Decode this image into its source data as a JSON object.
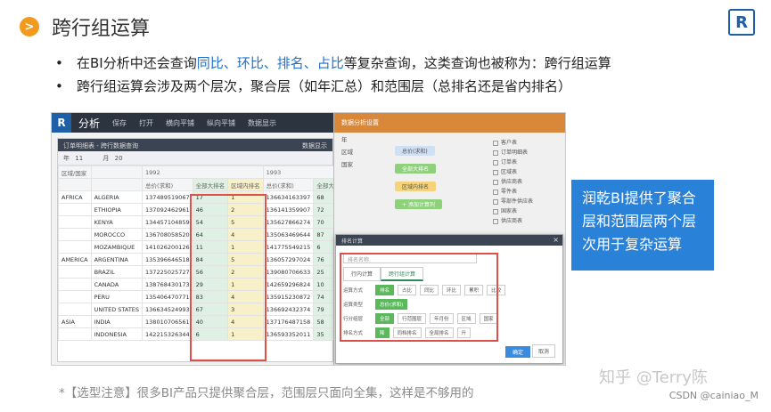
{
  "slide": {
    "title": "跨行组运算",
    "title_bullet": ">",
    "logo_letter": "R"
  },
  "bullets": {
    "line1_pre": "在BI分析中还会查询",
    "line1_highlight": "同比、环比、排名、占比",
    "line1_post": "等复杂查询，这类查询也被称为：跨行组运算",
    "line2": "跨行组运算会涉及两个层次，聚合层（如年汇总）和范围层（总排名还是省内排名）"
  },
  "app": {
    "logo": "R",
    "title": "分析",
    "menu": [
      "保存",
      "打开",
      "横向平铺",
      "纵向平铺",
      "数据显示"
    ],
    "panel_title": "订单明细表 - 跨行数据查询",
    "panel_right_label": "数据显示",
    "filter_year_label": "年",
    "filter_month_label": "月",
    "filter_value_a": "11",
    "filter_value_b": "20",
    "col_region": "区域/国家",
    "col_year_a": "1992",
    "col_year_b": "1993",
    "sub_headers": [
      "总价(求和)",
      "全部大排名",
      "区域内排名",
      "总价(求和)",
      "全部大排名"
    ],
    "rows": [
      {
        "region": "AFRICA",
        "country": "ALGERIA",
        "v1": "137489519067",
        "r1": "17",
        "r2": "1",
        "v2": "136634163397",
        "r3": "68"
      },
      {
        "region": "",
        "country": "ETHIOPIA",
        "v1": "137092462961",
        "r1": "46",
        "r2": "2",
        "v2": "136141359907",
        "r3": "72"
      },
      {
        "region": "",
        "country": "KENYA",
        "v1": "134457104859",
        "r1": "54",
        "r2": "5",
        "v2": "135627866274",
        "r3": "70"
      },
      {
        "region": "",
        "country": "MOROCCO",
        "v1": "136708058520",
        "r1": "64",
        "r2": "4",
        "v2": "135063469644",
        "r3": "87"
      },
      {
        "region": "",
        "country": "MOZAMBIQUE",
        "v1": "141026200126",
        "r1": "11",
        "r2": "1",
        "v2": "141775549215",
        "r3": "6"
      },
      {
        "region": "AMERICA",
        "country": "ARGENTINA",
        "v1": "135396646518",
        "r1": "84",
        "r2": "5",
        "v2": "136057297024",
        "r3": "76"
      },
      {
        "region": "",
        "country": "BRAZIL",
        "v1": "137225025727",
        "r1": "56",
        "r2": "2",
        "v2": "139080706633",
        "r3": "25"
      },
      {
        "region": "",
        "country": "CANADA",
        "v1": "138768430173",
        "r1": "29",
        "r2": "1",
        "v2": "142659296824",
        "r3": "10"
      },
      {
        "region": "",
        "country": "PERU",
        "v1": "135406470771",
        "r1": "83",
        "r2": "4",
        "v2": "135915230872",
        "r3": "74"
      },
      {
        "region": "",
        "country": "UNITED STATES",
        "v1": "136634524993",
        "r1": "67",
        "r2": "3",
        "v2": "136692432374",
        "r3": "79"
      },
      {
        "region": "ASIA",
        "country": "INDIA",
        "v1": "138010706561",
        "r1": "40",
        "r2": "4",
        "v2": "137176487158",
        "r3": "58"
      },
      {
        "region": "",
        "country": "INDONESIA",
        "v1": "142215326344",
        "r1": "6",
        "r2": "1",
        "v2": "136593352011",
        "r3": "35"
      }
    ],
    "right_panel": {
      "title": "数据分析设置",
      "field_year": "年",
      "field_region": "区域",
      "field_nation": "国家",
      "tag_total": "总价(求和)",
      "tag_rank_all": "全部大排名",
      "tag_rank_region": "区域内排名",
      "add_button": "+ 添加计算列",
      "checks": [
        "客户表",
        "订单明细表",
        "订单表",
        "区域表",
        "供应商表",
        "零件表",
        "零部件供应表",
        "国家表",
        "供应商表"
      ]
    },
    "dialog": {
      "title": "排名计算",
      "name_placeholder": "排名名称",
      "tab1": "行内计算",
      "tab2": "跨行组计算",
      "row1_label": "运算方式",
      "row1_chips": [
        "排名",
        "占比",
        "同比",
        "环比",
        "累积",
        "比较"
      ],
      "row2_label": "运算类型",
      "row2_chip": "总价(求和)",
      "row3_label": "行分组层",
      "row3_chips": [
        "全部",
        "行范围层",
        "年月份",
        "区域",
        "国家"
      ],
      "row4_label": "排名方式",
      "row4_chips": [
        "降",
        "同档排名",
        "全局排名",
        "升"
      ],
      "ok": "确定",
      "cancel": "取消"
    }
  },
  "callout": "润乾BI提供了聚合层和范围层两个层次用于复杂运算",
  "note": "*【选型注意】很多BI产品只提供聚合层，范围层只面向全集，这样是不够用的",
  "watermark": "知乎 @Terry陈",
  "credit": "CSDN @cainiao_M"
}
